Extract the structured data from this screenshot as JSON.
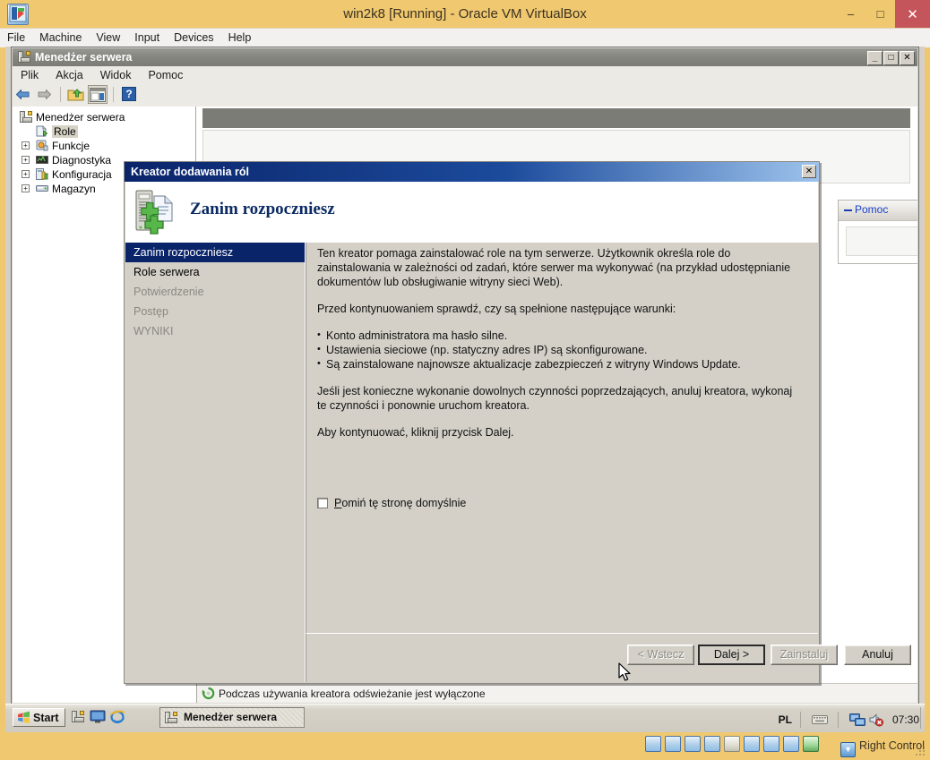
{
  "vbox": {
    "title": "win2k8 [Running] - Oracle VM VirtualBox",
    "app_icon": "virtualbox-vm-icon",
    "menus": [
      "File",
      "Machine",
      "View",
      "Input",
      "Devices",
      "Help"
    ],
    "window_buttons": {
      "minimize": "–",
      "maximize": "□",
      "close": "✕"
    },
    "status": {
      "host_key_label": "Right Control",
      "icons": [
        "hard-disk-icon",
        "optical-disk-icon",
        "network-icon",
        "usb-icon",
        "shared-folders-icon",
        "display-icon",
        "remote-desktop-icon",
        "video-capture-icon",
        "mouse-integration-icon",
        "host-key-icon"
      ]
    }
  },
  "server_manager": {
    "title": "Menedżer serwera",
    "title_icon": "server-manager-icon",
    "window_buttons": {
      "minimize": "_",
      "maximize": "□",
      "close": "✕"
    },
    "menus": [
      "Plik",
      "Akcja",
      "Widok",
      "Pomoc"
    ],
    "toolbar": [
      {
        "name": "back-button",
        "icon": "arrow-left-icon"
      },
      {
        "name": "forward-button",
        "icon": "arrow-right-icon"
      },
      {
        "name": "up-folder-button",
        "icon": "folder-up-icon"
      },
      {
        "name": "show-hide-console-tree-button",
        "icon": "console-tree-icon"
      },
      {
        "name": "help-button",
        "icon": "question-mark-icon"
      }
    ],
    "tree": [
      {
        "label": "Menedżer serwera",
        "icon": "server-manager-icon",
        "indent": 0,
        "expander": "",
        "selected": false
      },
      {
        "label": "Role",
        "icon": "roles-icon",
        "indent": 1,
        "expander": "",
        "selected": true
      },
      {
        "label": "Funkcje",
        "icon": "features-icon",
        "indent": 1,
        "expander": "+",
        "selected": false
      },
      {
        "label": "Diagnostyka",
        "icon": "diagnostics-icon",
        "indent": 1,
        "expander": "+",
        "selected": false
      },
      {
        "label": "Konfiguracja",
        "icon": "configuration-icon",
        "indent": 1,
        "expander": "+",
        "selected": false
      },
      {
        "label": "Magazyn",
        "icon": "storage-icon",
        "indent": 1,
        "expander": "+",
        "selected": false
      }
    ],
    "help_panel": {
      "label": "Pomoc"
    },
    "status_text": "Podczas używania kreatora odświeżanie jest wyłączone",
    "status_icon": "refresh-disabled-icon"
  },
  "taskbar": {
    "start_label": "Start",
    "start_icon": "windows-flag-icon",
    "quick_launch": [
      {
        "name": "server-manager-quicklaunch",
        "icon": "server-manager-icon"
      },
      {
        "name": "show-desktop-quicklaunch",
        "icon": "show-desktop-icon"
      },
      {
        "name": "internet-explorer-quicklaunch",
        "icon": "internet-explorer-icon"
      }
    ],
    "tasks": [
      {
        "label": "Menedżer serwera",
        "icon": "server-manager-icon",
        "active": true
      }
    ],
    "tray": {
      "language": "PL",
      "keyboard_icon": "keyboard-icon",
      "network_icon": "network-icon",
      "volume_icon": "volume-muted-icon",
      "clock": "07:30"
    }
  },
  "wizard": {
    "title": "Kreator dodawania ról",
    "close_glyph": "✕",
    "header_title": "Zanim rozpoczniesz",
    "header_icon": "add-roles-server-icon",
    "nav": [
      {
        "label": "Zanim rozpoczniesz",
        "state": "active"
      },
      {
        "label": "Role serwera",
        "state": "done"
      },
      {
        "label": "Potwierdzenie",
        "state": "pending"
      },
      {
        "label": "Postęp",
        "state": "pending"
      },
      {
        "label": "WYNIKI",
        "state": "pending"
      }
    ],
    "body": {
      "paragraph1": "Ten kreator pomaga zainstalować role na tym serwerze. Użytkownik określa role do zainstalowania w zależności od zadań, które serwer ma wykonywać (na przykład udostępnianie dokumentów lub obsługiwanie witryny sieci Web).",
      "paragraph2": "Przed kontynuowaniem sprawdź, czy są spełnione następujące warunki:",
      "bullets": [
        "Konto administratora ma hasło silne.",
        "Ustawienia sieciowe (np. statyczny adres IP) są skonfigurowane.",
        "Są zainstalowane najnowsze aktualizacje zabezpieczeń z witryny Windows Update."
      ],
      "paragraph3": "Jeśli jest konieczne wykonanie dowolnych czynności poprzedzających, anuluj kreatora, wykonaj te czynności i ponownie uruchom kreatora.",
      "paragraph4": "Aby kontynuować, kliknij przycisk Dalej."
    },
    "skip_checkbox": {
      "label_prefix": "",
      "accel": "P",
      "label_rest": "omiń tę stronę domyślnie",
      "checked": false
    },
    "buttons": {
      "back": "< Wstecz",
      "back_accel": "W",
      "next": "Dalej >",
      "next_accel": "D",
      "install": "Zainstaluj",
      "install_accel": "Z",
      "cancel": "Anuluj"
    }
  },
  "colors": {
    "vbox_chrome": "#f0c86f",
    "vbox_close": "#c4555a",
    "dialog_title": "#0a246a",
    "dialog_face": "#d4d0c8",
    "nav_active": "#0a246a",
    "link_blue": "#1a3fcf",
    "mmc_title": "#85857f"
  }
}
